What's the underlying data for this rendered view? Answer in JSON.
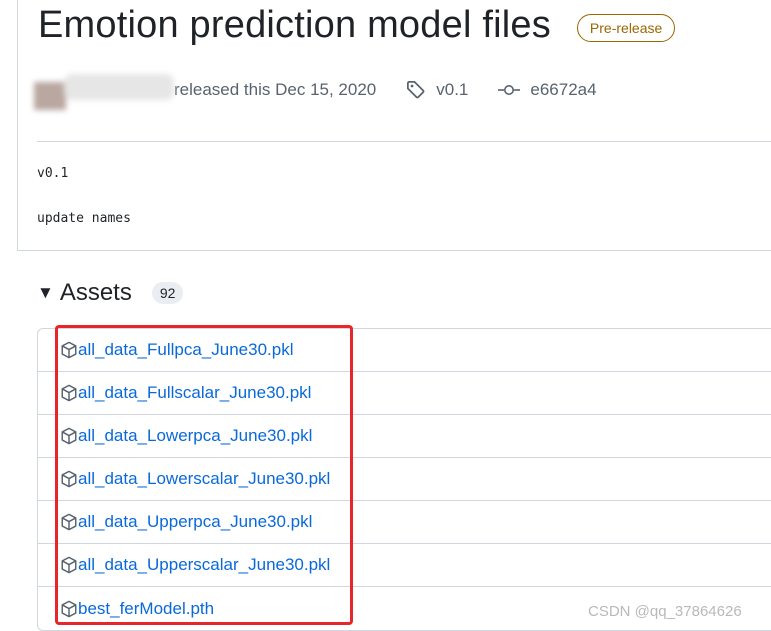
{
  "release": {
    "title": "Emotion prediction model files",
    "prerelease_badge": "Pre-release",
    "released_text": "released this Dec 15, 2020",
    "tag": "v0.1",
    "commit": "e6672a4"
  },
  "body": {
    "line1": "v0.1",
    "line2": "update names"
  },
  "assets": {
    "title": "Assets",
    "count": "92",
    "items": [
      {
        "name": "all_data_Fullpca_June30.pkl"
      },
      {
        "name": "all_data_Fullscalar_June30.pkl"
      },
      {
        "name": "all_data_Lowerpca_June30.pkl"
      },
      {
        "name": "all_data_Lowerscalar_June30.pkl"
      },
      {
        "name": "all_data_Upperpca_June30.pkl"
      },
      {
        "name": "all_data_Upperscalar_June30.pkl"
      },
      {
        "name": "best_ferModel.pth"
      }
    ]
  },
  "watermark": "CSDN @qq_37864626",
  "icons": {
    "tag": "tag-icon",
    "commit": "git-commit-icon",
    "asset": "package-icon",
    "caret": "triangle-down-icon"
  },
  "colors": {
    "link": "#0969da",
    "prerelease": "#9a6700",
    "highlight": "#e8262a"
  }
}
